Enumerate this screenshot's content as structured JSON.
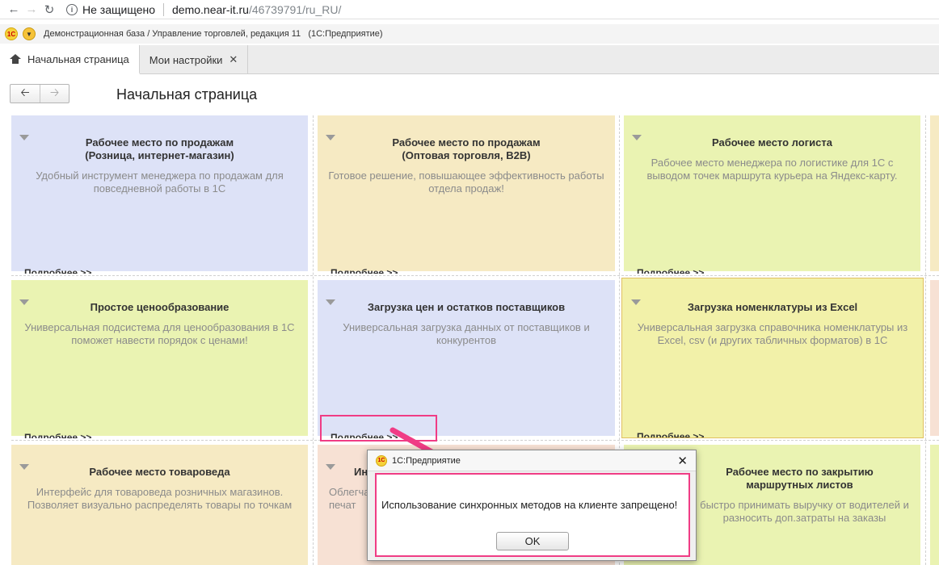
{
  "browser": {
    "security_label": "Не защищено",
    "url_domain": "demo.near-it.ru",
    "url_path": "/46739791/ru_RU/"
  },
  "app": {
    "title": "Демонстрационная база / Управление торговлей, редакция 11   (1С:Предприятие)",
    "logo_text": "1С"
  },
  "tabs": [
    {
      "label": "Начальная страница"
    },
    {
      "label": "Мои настройки"
    }
  ],
  "page": {
    "title": "Начальная страница"
  },
  "tiles": [
    {
      "title": "Рабочее место по продажам\n(Розница, интернет-магазин)",
      "desc": "Удобный инструмент менеджера по продажам для\nповседневной работы в 1С",
      "more": "Подробнее >>"
    },
    {
      "title": "Рабочее место по продажам\n(Оптовая торговля, B2B)",
      "desc": "Готовое решение, повышающее эффективность работы\nотдела продаж!",
      "more": "Подробнее >>"
    },
    {
      "title": "Рабочее место логиста",
      "desc": "Рабочее место менеджера по логистике для 1С с\nвыводом точек маршрута курьера на Яндекс-карту.",
      "more": "Подробнее >>"
    },
    {
      "title": "Простое ценообразование",
      "desc": "Универсальная подсистема для ценообразования в 1С\nпоможет навести порядок с ценами!",
      "more": "Подробнее >>"
    },
    {
      "title": "Загрузка цен и остатков поставщиков",
      "desc": "Универсальная загрузка данных от поставщиков и\nконкурентов",
      "more": "Подробнее >>"
    },
    {
      "title": "Загрузка номенклатуры из Excel",
      "desc": "Универсальная загрузка справочника номенклатуры из\nExcel, csv (и других табличных форматов) в 1С",
      "more": "Подробнее >>"
    },
    {
      "title": "Рабочее место товароведа",
      "desc": "Интерфейс для товароведа розничных магазинов.\nПозволяет визуально распределять товары по точкам",
      "more": ""
    },
    {
      "title": "Ин",
      "desc": "Облегча\nпечат",
      "more": ""
    },
    {
      "title": "Рабочее место по закрытию\nмаршрутных листов",
      "desc": "быстро принимать выручку от водителей и\nразносить доп.затраты на заказы",
      "more": ""
    }
  ],
  "dialog": {
    "title": "1С:Предприятие",
    "message": "Использование синхронных методов на клиенте запрещено!",
    "ok_label": "OK"
  }
}
